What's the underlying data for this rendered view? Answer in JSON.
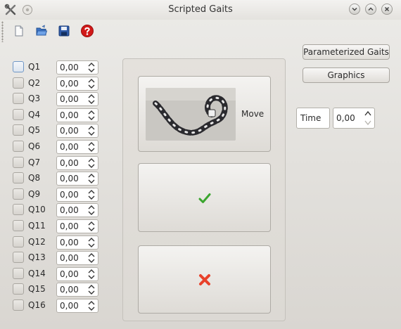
{
  "window": {
    "title": "Scripted Gaits"
  },
  "toolbar": {
    "icons": [
      "new-document-icon",
      "open-folder-icon",
      "save-disk-icon",
      "help-icon"
    ]
  },
  "joints": [
    {
      "label": "Q1",
      "value": "0,00"
    },
    {
      "label": "Q2",
      "value": "0,00"
    },
    {
      "label": "Q3",
      "value": "0,00"
    },
    {
      "label": "Q4",
      "value": "0,00"
    },
    {
      "label": "Q5",
      "value": "0,00"
    },
    {
      "label": "Q6",
      "value": "0,00"
    },
    {
      "label": "Q7",
      "value": "0,00"
    },
    {
      "label": "Q8",
      "value": "0,00"
    },
    {
      "label": "Q9",
      "value": "0,00"
    },
    {
      "label": "Q10",
      "value": "0,00"
    },
    {
      "label": "Q11",
      "value": "0,00"
    },
    {
      "label": "Q12",
      "value": "0,00"
    },
    {
      "label": "Q13",
      "value": "0,00"
    },
    {
      "label": "Q14",
      "value": "0,00"
    },
    {
      "label": "Q15",
      "value": "0,00"
    },
    {
      "label": "Q16",
      "value": "0,00"
    }
  ],
  "actions": {
    "move_label": "Move",
    "confirm_icon": "checkmark-icon",
    "cancel_icon": "cross-icon"
  },
  "side": {
    "parameterized_label": "Parameterized Gaits",
    "graphics_label": "Graphics",
    "time_label": "Time",
    "time_value": "0,00"
  },
  "colors": {
    "check": "#3aa52e",
    "cross": "#e8412a",
    "help": "#d11919"
  }
}
